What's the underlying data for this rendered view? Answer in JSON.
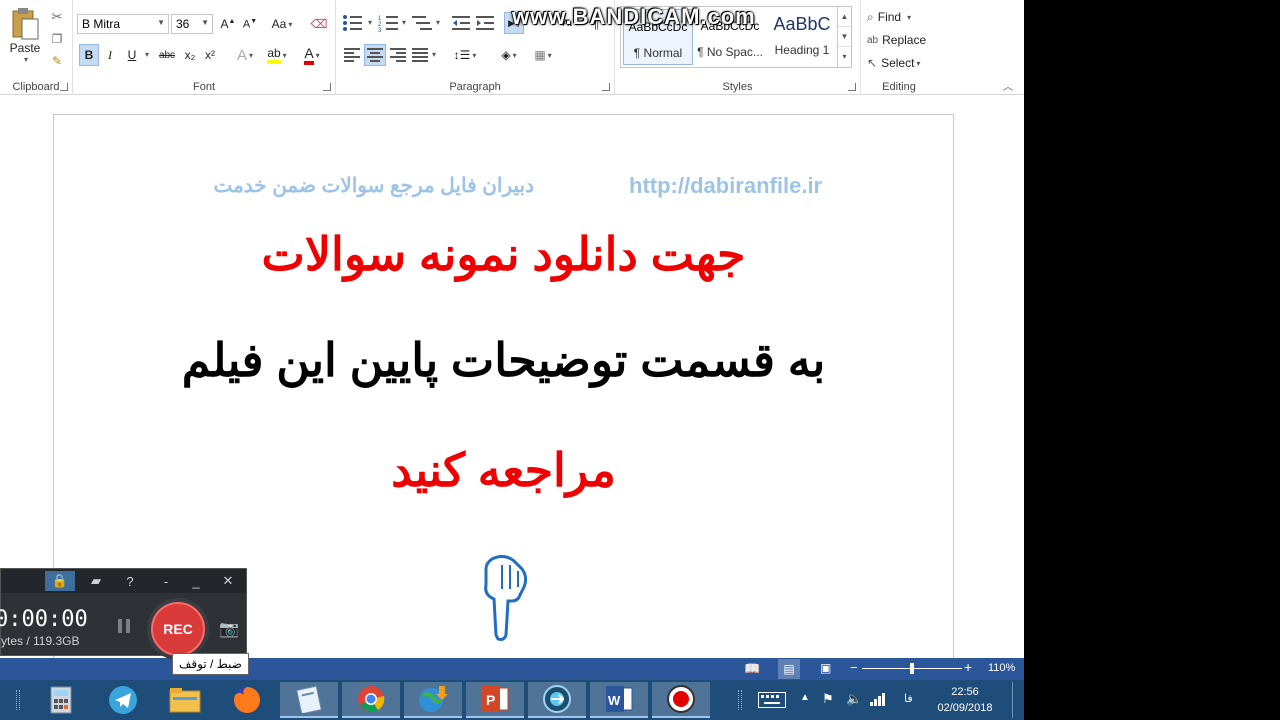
{
  "ribbon": {
    "clipboard": {
      "label": "Clipboard",
      "paste_label": "Paste"
    },
    "font": {
      "label": "Font",
      "font_name": "B Mitra",
      "font_size": "36",
      "bold": "B",
      "italic": "I",
      "underline": "U",
      "strike": "abc",
      "subscript": "x₂",
      "superscript": "x²",
      "case": "Aa"
    },
    "paragraph": {
      "label": "Paragraph"
    },
    "styles": {
      "label": "Styles",
      "items": [
        {
          "preview": "AaBbCcDc",
          "name": "¶ Normal"
        },
        {
          "preview": "AaBbCcDc",
          "name": "¶ No Spac..."
        },
        {
          "preview": "AaBbC",
          "name": "Heading 1"
        }
      ]
    },
    "editing": {
      "label": "Editing",
      "find": "Find",
      "replace": "Replace",
      "select": "Select"
    }
  },
  "watermark": "www.BANDICAM.com",
  "document": {
    "url": "http://dabiranfile.ir",
    "tagline": "دبیران فایل مرجع سوالات ضمن خدمت",
    "line1": "جهت دانلود نمونه سوالات",
    "line2": "به قسمت توضیحات پایین این فیلم",
    "line3": "مراجعه کنید"
  },
  "statusbar": {
    "zoom": "110%"
  },
  "bandicam": {
    "timer": "0:00:00",
    "storage": "ytes / 119.3GB",
    "rec_label": "REC",
    "tooltip": "ضبط / توقف"
  },
  "taskbar": {
    "time": "22:56",
    "date": "02/09/2018",
    "lang": "فا"
  },
  "colors": {
    "accent": "#2b579a",
    "red_text": "#ee0000",
    "light_blue_text": "#9dc3e6"
  }
}
